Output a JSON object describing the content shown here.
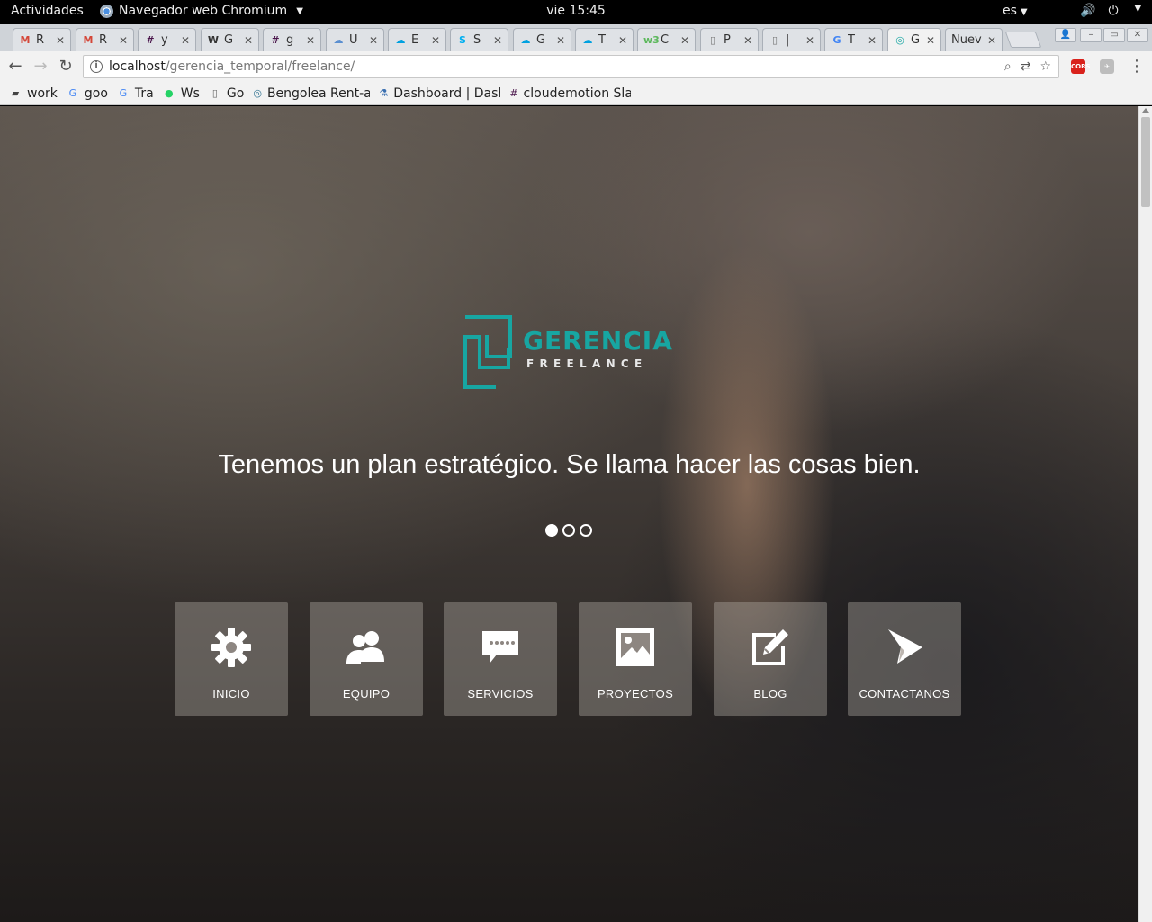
{
  "topbar": {
    "activities": "Actividades",
    "app_name": "Navegador web Chromium",
    "clock": "vie 15:45",
    "lang": "es"
  },
  "tabs": [
    {
      "title": "R",
      "icon": "gmail-icon",
      "color": "#d44638"
    },
    {
      "title": "R",
      "icon": "gmail-icon",
      "color": "#d44638"
    },
    {
      "title": "y",
      "icon": "slack-icon",
      "color": "#4a154b"
    },
    {
      "title": "G",
      "icon": "wikipedia-icon",
      "color": "#333333"
    },
    {
      "title": "g",
      "icon": "slack-icon",
      "color": "#4a154b"
    },
    {
      "title": "U",
      "icon": "cloud-icon",
      "color": "#5b8fd0"
    },
    {
      "title": "E",
      "icon": "salesforce-icon",
      "color": "#00a1e0"
    },
    {
      "title": "S",
      "icon": "skype-icon",
      "color": "#00aff0"
    },
    {
      "title": "G",
      "icon": "salesforce-icon",
      "color": "#00a1e0"
    },
    {
      "title": "T",
      "icon": "salesforce-icon",
      "color": "#00a1e0"
    },
    {
      "title": "C",
      "icon": "w3c-icon",
      "color": "#5cb85c"
    },
    {
      "title": "P",
      "icon": "page-icon",
      "color": "#777777"
    },
    {
      "title": "|",
      "icon": "page-icon",
      "color": "#777777"
    },
    {
      "title": "T",
      "icon": "translate-icon",
      "color": "#4285f4"
    },
    {
      "title": "G",
      "icon": "site-icon",
      "color": "#17a6a2"
    },
    {
      "title": "Nuev",
      "icon": "",
      "color": ""
    }
  ],
  "toolbar": {
    "url_host": "localhost",
    "url_path": "/gerencia_temporal/freelance/"
  },
  "bookmarks": [
    {
      "label": "work",
      "icon": "folder-icon"
    },
    {
      "label": "goo",
      "icon": "google-icon"
    },
    {
      "label": "Tra",
      "icon": "translate-icon"
    },
    {
      "label": "Ws",
      "icon": "whatsapp-icon"
    },
    {
      "label": "Go",
      "icon": "page-icon"
    },
    {
      "label": "Bengolea Rent-a-F",
      "icon": "site-icon"
    },
    {
      "label": "Dashboard | Dashl",
      "icon": "dashboard-icon"
    },
    {
      "label": "cloudemotion Slac",
      "icon": "slack-icon"
    }
  ],
  "hero": {
    "logo_word": "GERENCIA",
    "logo_sub": "FREELANCE",
    "tagline": "Tenemos un plan estratégico. Se llama hacer las cosas bien.",
    "slides": 3,
    "active_slide": 1
  },
  "menu": [
    {
      "label": "INICIO",
      "icon": "gear-icon"
    },
    {
      "label": "EQUIPO",
      "icon": "users-icon"
    },
    {
      "label": "SERVICIOS",
      "icon": "chat-icon"
    },
    {
      "label": "PROYECTOS",
      "icon": "image-icon"
    },
    {
      "label": "BLOG",
      "icon": "edit-icon"
    },
    {
      "label": "CONTACTANOS",
      "icon": "send-icon"
    }
  ],
  "colors": {
    "brand": "#17a6a2",
    "card_bg": "rgba(185,178,172,0.38)"
  }
}
